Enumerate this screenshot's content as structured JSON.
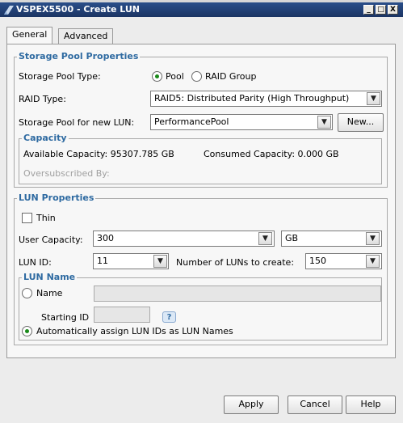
{
  "window": {
    "title": "VSPEX5500 - Create LUN",
    "controls": {
      "minimize": "_",
      "maximize": "□",
      "close": "X"
    }
  },
  "tabs": [
    {
      "label": "General",
      "active": true
    },
    {
      "label": "Advanced",
      "active": false
    }
  ],
  "storage_pool": {
    "group_title": "Storage Pool Properties",
    "type_label": "Storage Pool Type:",
    "type_options": {
      "pool": "Pool",
      "raid_group": "RAID Group",
      "selected": "pool"
    },
    "raid_type_label": "RAID Type:",
    "raid_type_value": "RAID5: Distributed Parity (High Throughput)",
    "pool_label": "Storage Pool for new LUN:",
    "pool_value": "PerformancePool",
    "new_button": "New..."
  },
  "capacity": {
    "group_title": "Capacity",
    "available": "Available Capacity: 95307.785 GB",
    "consumed": "Consumed Capacity: 0.000 GB",
    "oversubscribed": "Oversubscribed By:"
  },
  "lun_properties": {
    "group_title": "LUN Properties",
    "thin_label": "Thin",
    "thin_checked": false,
    "user_capacity_label": "User Capacity:",
    "user_capacity_value": "300",
    "unit_value": "GB",
    "lun_id_label": "LUN ID:",
    "lun_id_value": "11",
    "num_luns_label": "Number of LUNs to create:",
    "num_luns_value": "150"
  },
  "lun_name": {
    "group_title": "LUN Name",
    "name_option": "Name",
    "starting_id_label": "Starting ID",
    "help_icon": "?",
    "auto_option": "Automatically assign LUN IDs as LUN Names",
    "selected": "auto"
  },
  "footer": {
    "apply": "Apply",
    "cancel": "Cancel",
    "help": "Help"
  },
  "colors": {
    "titlebar": "#1b3463",
    "group_title": "#2e6aa1",
    "radio_selected": "#1a8a1a"
  },
  "icons": {
    "window": "app-window-icon",
    "dropdown": "chevron-down-icon",
    "help": "help-icon"
  }
}
